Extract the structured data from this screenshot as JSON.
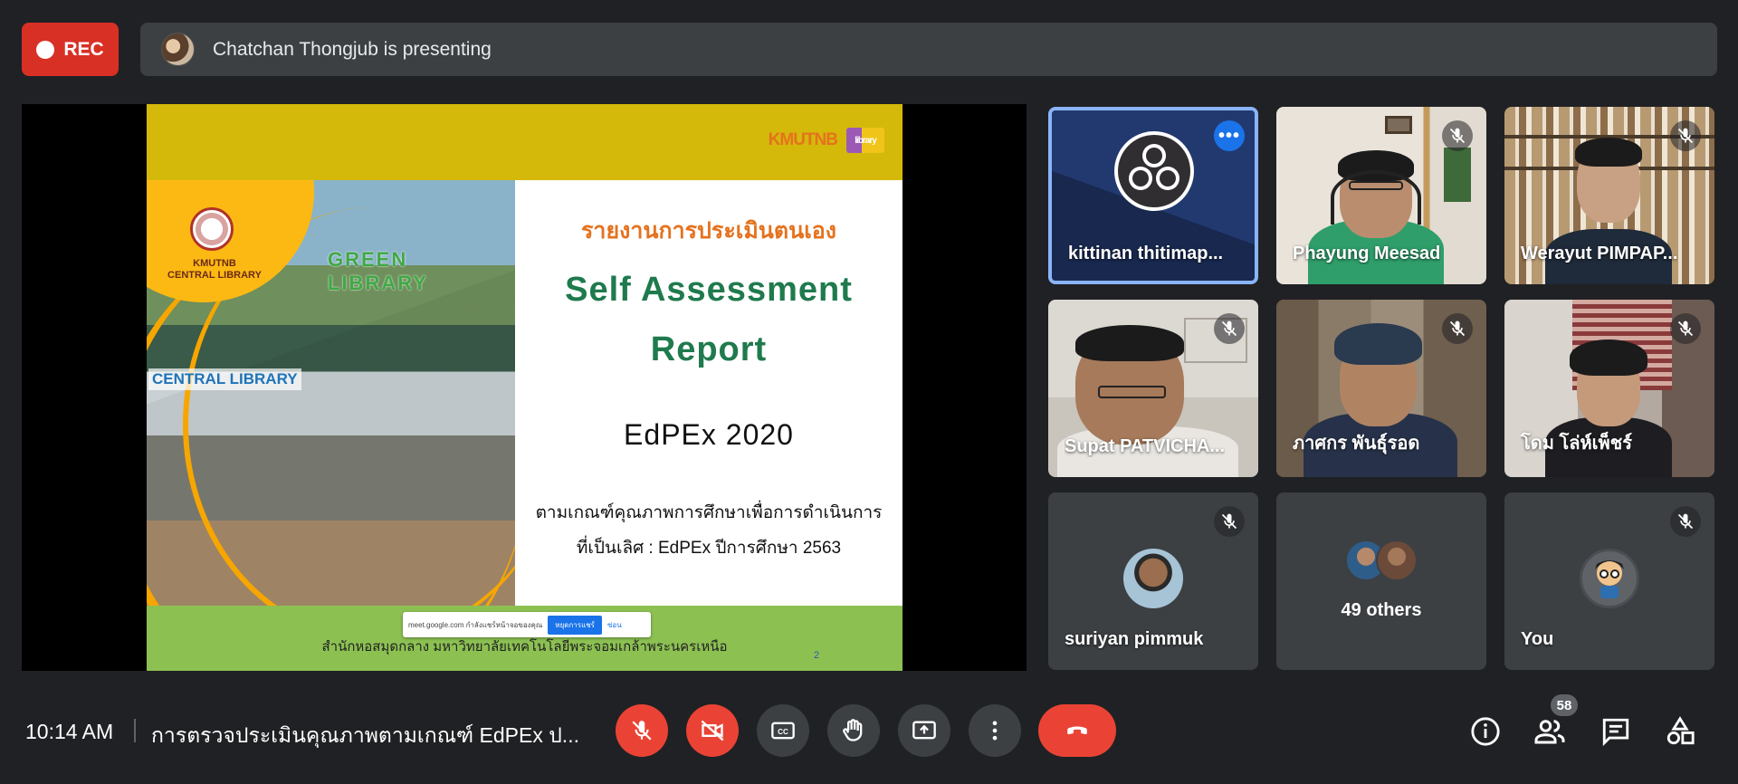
{
  "recording": {
    "label": "REC"
  },
  "presenter_bar": {
    "text": "Chatchan Thongjub is presenting"
  },
  "slide": {
    "logo_text": "KMUTNB",
    "logo_sub": "library",
    "seal_caption_1": "KMUTNB",
    "seal_caption_2": "CENTRAL LIBRARY",
    "green_library": "GREEN LIBRARY",
    "central_library_sign": "CENTRAL LIBRARY",
    "title_th": "รายงานการประเมินตนเอง",
    "title_en_1": "Self Assessment",
    "title_en_2": "Report",
    "edpex": "EdPEx 2020",
    "subtitle_1": "ตามเกณฑ์คุณภาพการศึกษาเพื่อการดำเนินการ",
    "subtitle_2": "ที่เป็นเลิศ : EdPEx ปีการศึกษา 2563",
    "footer": "สำนักหอสมุดกลาง มหาวิทยาลัยเทคโนโลยีพระจอมเกล้าพระนครเหนือ",
    "page_number": "2",
    "share_notice": {
      "text": "meet.google.com กำลังแชร์หน้าจอของคุณ",
      "stop": "หยุดการแชร์",
      "hide": "ซ่อน"
    }
  },
  "participants": [
    {
      "name": "kittinan thitimap...",
      "muted": false,
      "active": true,
      "icon": "obs-logo"
    },
    {
      "name": "Phayung Meesad",
      "muted": true
    },
    {
      "name": "Werayut PIMPAP...",
      "muted": true
    },
    {
      "name": "Supat PATVICHA...",
      "muted": true
    },
    {
      "name": "ภาศกร พันธุ์รอด",
      "muted": true
    },
    {
      "name": "โดม โล่ห์เพ็ชร์",
      "muted": true
    },
    {
      "name": "suriyan pimmuk",
      "muted": true
    },
    {
      "name": "49 others",
      "muted": false
    },
    {
      "name": "You",
      "muted": true
    }
  ],
  "bottom_bar": {
    "time": "10:14 AM",
    "meeting_title": "การตรวจประเมินคุณภาพตามเกณฑ์ EdPEx ป...",
    "participant_count": "58"
  },
  "colors": {
    "accent_red": "#ea4335",
    "active_tile": "#8ab4f8",
    "primary_blue": "#1a73e8",
    "bg": "#202124"
  }
}
